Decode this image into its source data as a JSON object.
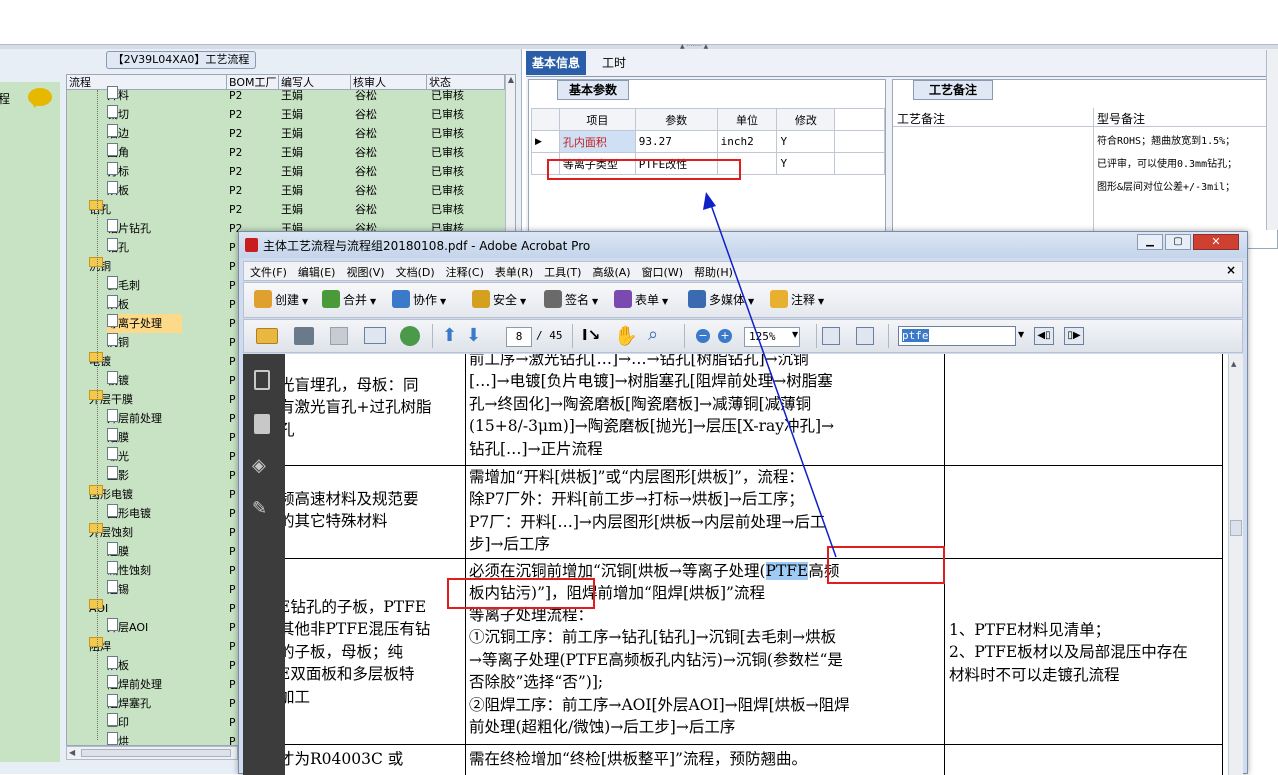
{
  "left": {
    "header_title": "【2V39L04XA0】工艺流程",
    "side_label": "程",
    "columns": [
      "流程",
      "BOM工厂",
      "编写人",
      "核审人",
      "状态"
    ],
    "rows": [
      {
        "name": "开料",
        "kind": "file",
        "indent": 2,
        "f": "P2",
        "w": "王娟",
        "r": "谷松",
        "s": "已审核"
      },
      {
        "name": "裁切",
        "kind": "file",
        "indent": 2,
        "f": "P2",
        "w": "王娟",
        "r": "谷松",
        "s": "已审核"
      },
      {
        "name": "磨边",
        "kind": "file",
        "indent": 2,
        "f": "P2",
        "w": "王娟",
        "r": "谷松",
        "s": "已审核"
      },
      {
        "name": "圆角",
        "kind": "file",
        "indent": 2,
        "f": "P2",
        "w": "王娟",
        "r": "谷松",
        "s": "已审核"
      },
      {
        "name": "打标",
        "kind": "file",
        "indent": 2,
        "f": "P2",
        "w": "王娟",
        "r": "谷松",
        "s": "已审核"
      },
      {
        "name": "烘板",
        "kind": "file",
        "indent": 2,
        "f": "P2",
        "w": "王娟",
        "r": "谷松",
        "s": "已审核"
      },
      {
        "name": "钻孔",
        "kind": "dir",
        "indent": 1,
        "f": "P2",
        "w": "王娟",
        "r": "谷松",
        "s": "已审核"
      },
      {
        "name": "铝片钻孔",
        "kind": "file",
        "indent": 2,
        "f": "P2",
        "w": "王娟",
        "r": "谷松",
        "s": "已审核"
      },
      {
        "name": "钻孔",
        "kind": "file",
        "indent": 2,
        "f": "P:",
        "w": "",
        "r": "",
        "s": ""
      },
      {
        "name": "沉铜",
        "kind": "dir",
        "indent": 1,
        "f": "P:",
        "w": "",
        "r": "",
        "s": ""
      },
      {
        "name": "去毛刺",
        "kind": "file",
        "indent": 2,
        "f": "P:",
        "w": "",
        "r": "",
        "s": ""
      },
      {
        "name": "烘板",
        "kind": "file",
        "indent": 2,
        "f": "P:",
        "w": "",
        "r": "",
        "s": ""
      },
      {
        "name": "等离子处理",
        "kind": "file",
        "indent": 2,
        "f": "P:",
        "w": "",
        "r": "",
        "s": "",
        "sel": true
      },
      {
        "name": "沉铜",
        "kind": "file",
        "indent": 2,
        "f": "P:",
        "w": "",
        "r": "",
        "s": ""
      },
      {
        "name": "电镀",
        "kind": "dir",
        "indent": 1,
        "f": "P:",
        "w": "",
        "r": "",
        "s": ""
      },
      {
        "name": "板镀",
        "kind": "file",
        "indent": 2,
        "f": "P:",
        "w": "",
        "r": "",
        "s": ""
      },
      {
        "name": "外层干膜",
        "kind": "dir",
        "indent": 1,
        "f": "P:",
        "w": "",
        "r": "",
        "s": ""
      },
      {
        "name": "外层前处理",
        "kind": "file",
        "indent": 2,
        "f": "P:",
        "w": "",
        "r": "",
        "s": ""
      },
      {
        "name": "贴膜",
        "kind": "file",
        "indent": 2,
        "f": "P:",
        "w": "",
        "r": "",
        "s": ""
      },
      {
        "name": "曝光",
        "kind": "file",
        "indent": 2,
        "f": "P:",
        "w": "",
        "r": "",
        "s": ""
      },
      {
        "name": "显影",
        "kind": "file",
        "indent": 2,
        "f": "P:",
        "w": "",
        "r": "",
        "s": ""
      },
      {
        "name": "图形电镀",
        "kind": "dir",
        "indent": 1,
        "f": "P:",
        "w": "",
        "r": "",
        "s": ""
      },
      {
        "name": "图形电镀",
        "kind": "file",
        "indent": 2,
        "f": "P:",
        "w": "",
        "r": "",
        "s": ""
      },
      {
        "name": "外层蚀刻",
        "kind": "dir",
        "indent": 1,
        "f": "P:",
        "w": "",
        "r": "",
        "s": ""
      },
      {
        "name": "退膜",
        "kind": "file",
        "indent": 2,
        "f": "P:",
        "w": "",
        "r": "",
        "s": ""
      },
      {
        "name": "碱性蚀刻",
        "kind": "file",
        "indent": 2,
        "f": "P:",
        "w": "",
        "r": "",
        "s": ""
      },
      {
        "name": "退锡",
        "kind": "file",
        "indent": 2,
        "f": "P:",
        "w": "",
        "r": "",
        "s": ""
      },
      {
        "name": "AOI",
        "kind": "dir",
        "indent": 1,
        "f": "P:",
        "w": "",
        "r": "",
        "s": ""
      },
      {
        "name": "外层AOI",
        "kind": "file",
        "indent": 2,
        "f": "P:",
        "w": "",
        "r": "",
        "s": ""
      },
      {
        "name": "阻焊",
        "kind": "dir",
        "indent": 1,
        "f": "P:",
        "w": "",
        "r": "",
        "s": ""
      },
      {
        "name": "烘板",
        "kind": "file",
        "indent": 2,
        "f": "P:",
        "w": "",
        "r": "",
        "s": ""
      },
      {
        "name": "阻焊前处理",
        "kind": "file",
        "indent": 2,
        "f": "P:",
        "w": "",
        "r": "",
        "s": ""
      },
      {
        "name": "阻焊塞孔",
        "kind": "file",
        "indent": 2,
        "f": "P:",
        "w": "",
        "r": "",
        "s": ""
      },
      {
        "name": "丝印",
        "kind": "file",
        "indent": 2,
        "f": "P:",
        "w": "",
        "r": "",
        "s": ""
      },
      {
        "name": "预烘",
        "kind": "file",
        "indent": 2,
        "f": "P:",
        "w": "",
        "r": "",
        "s": ""
      }
    ]
  },
  "right": {
    "tab_basic": "基本信息",
    "tab_hours": "工时",
    "section_params": "基本参数",
    "section_notes": "工艺备注",
    "param_columns": [
      "项目",
      "参数",
      "单位",
      "修改"
    ],
    "params": [
      {
        "item": "孔内面积",
        "value": "93.27",
        "unit": "inch2",
        "mod": "Y"
      },
      {
        "item": "等离子类型",
        "value": "PTFE改性",
        "unit": "",
        "mod": "Y"
      }
    ],
    "notes_col1": "工艺备注",
    "notes_col2": "型号备注",
    "model_notes": [
      "符合ROHS；翘曲放宽到1.5%；",
      "已评审，可以使用0.3mm钻孔；",
      "图形&层间对位公差+/-3mil；"
    ]
  },
  "acrobat": {
    "title": "主体工艺流程与流程组20180108.pdf - Adobe Acrobat Pro",
    "menu": [
      "文件(F)",
      "编辑(E)",
      "视图(V)",
      "文档(D)",
      "注释(C)",
      "表单(R)",
      "工具(T)",
      "高级(A)",
      "窗口(W)",
      "帮助(H)"
    ],
    "toolbar1": [
      {
        "label": "创建",
        "icon": "create-icon",
        "color": "#e0a030"
      },
      {
        "label": "合并",
        "icon": "combine-icon",
        "color": "#4a9a3a"
      },
      {
        "label": "协作",
        "icon": "collaborate-icon",
        "color": "#3a7ac8"
      },
      {
        "label": "安全",
        "icon": "lock-icon",
        "color": "#d4a020"
      },
      {
        "label": "签名",
        "icon": "sign-icon",
        "color": "#6a6a6a"
      },
      {
        "label": "表单",
        "icon": "form-icon",
        "color": "#7a4ab0"
      },
      {
        "label": "多媒体",
        "icon": "multimedia-icon",
        "color": "#3a6ab0"
      },
      {
        "label": "注释",
        "icon": "comment-icon",
        "color": "#e8b030"
      }
    ],
    "page_current": "8",
    "page_total": "/ 45",
    "zoom": "125%",
    "search": "ptfe",
    "doc": {
      "r1c1": "光盲埋孔，母板：同\n有激光盲孔+过孔树脂\n孔",
      "r1c2": "前工序→激光钻孔[…]→…→钻孔[树脂钻孔]→沉铜\n[…]→电镀[负片电镀]→树脂塞孔[阻焊前处理→树脂塞\n孔→终固化]→陶瓷磨板[陶瓷磨板]→减薄铜[减薄铜\n(15+8/-3μm)]→陶瓷磨板[抛光]→层压[X-ray冲孔]→\n钻孔[…]→正片流程",
      "r2c1": "频高速材料及规范要\n的其它特殊材料",
      "r2c2": "需增加“开料[烘板]”或“内层图形[烘板]”，流程：\n除P7厂外：开料[前工步→打标→烘板]→后工序；\nP7厂：开料[…]→内层图形[烘板→内层前处理→后工\n步]→后工序",
      "r3c1": "E钻孔的子板，PTFE\n其他非PTFE混压有钻\n的子板，母板；纯\nE双面板和多层板特\n加工",
      "r3c2_l1a": "必须在沉铜前增加“沉铜[烘板→等离子处理(",
      "r3c2_l1hl": "PTFE",
      "r3c2_l1b": "高频",
      "r3c2_l2a": "板内钻污)",
      "r3c2_l2b": "”]，阻焊前增加“阻焊[烘板]”流程",
      "r3c2_rest": "等离子处理流程：\n①沉铜工序：前工序→钻孔[钻孔]→沉铜[去毛刺→烘板\n→等离子处理(PTFE高频板孔内钻污)→沉铜(参数栏“是\n否除胶”选择“否”)];\n②阻焊工序：前工序→AOI[外层AOI]→阻焊[烘板→阻焊\n前处理(超粗化/微蚀)→后工步]→后工序",
      "r3c3": "1、PTFE材料见清单；\n2、PTFE板材以及局部混压中存在\n材料时不可以走镀孔流程",
      "r4c1": "才为R04003C 或",
      "r4c2": "需在终检增加“终检[烘板整平]”流程，预防翘曲。"
    }
  }
}
